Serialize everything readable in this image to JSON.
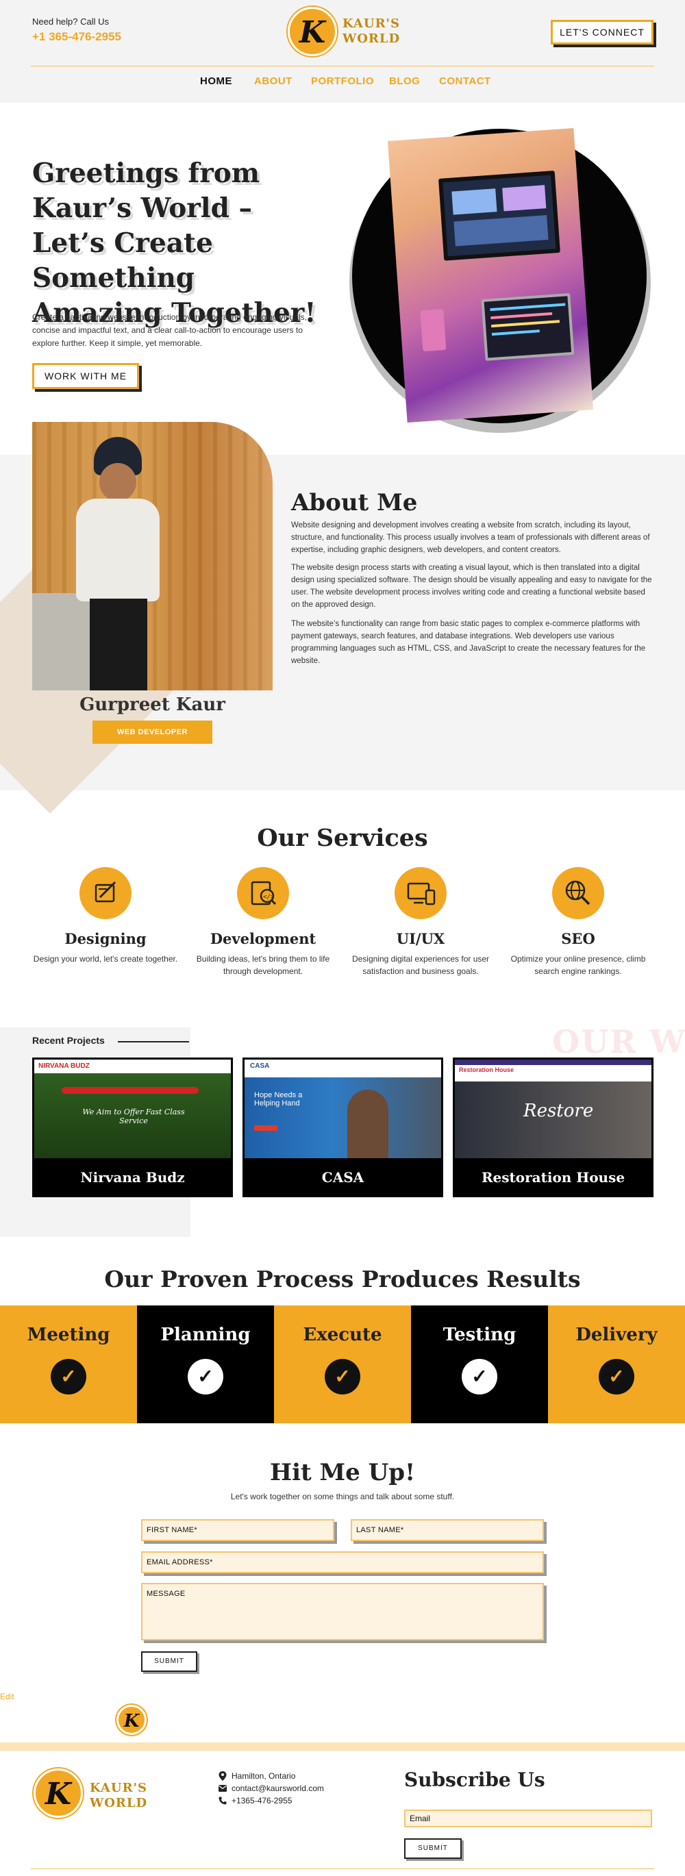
{
  "header": {
    "help_text": "Need help? Call Us",
    "phone": "+1 365-476-2955",
    "logo_line1": "KAUR'S",
    "logo_line2": "WORLD",
    "connect_label": "LET'S CONNECT",
    "nav": [
      {
        "label": "HOME",
        "active": true
      },
      {
        "label": "ABOUT"
      },
      {
        "label": "PORTFOLIO"
      },
      {
        "label": "BLOG"
      },
      {
        "label": "CONTACT"
      }
    ]
  },
  "hero": {
    "title": "Greetings from Kaur’s World – Let’s Create Something Amazing Together!",
    "text": "Create a captivating website introduction by incorporating engaging visuals, concise and impactful text, and a clear call-to-action to encourage users to explore further. Keep it simple, yet memorable.",
    "button_label": "WORK WITH ME"
  },
  "about": {
    "title": "About Me",
    "paragraphs": [
      "Website designing and development involves creating a website from scratch, including its layout, structure, and functionality. This process usually involves a team of professionals with different areas of expertise, including graphic designers, web developers, and content creators.",
      "The website design process starts with creating a visual layout, which is then translated into a digital design using specialized software. The design should be visually appealing and easy to navigate for the user. The website development process involves writing code and creating a functional website based on the approved design.",
      "The website’s functionality can range from basic static pages to complex e-commerce platforms with payment gateways, search features, and database integrations. Web developers use various programming languages such as HTML, CSS, and JavaScript to create the necessary features for the website."
    ],
    "name": "Gurpreet Kaur",
    "role": "WEB DEVELOPER"
  },
  "services": {
    "title": "Our Services",
    "items": [
      {
        "name": "Designing",
        "desc": "Design your world, let's create together.",
        "icon": "design-tool-icon"
      },
      {
        "name": "Development",
        "desc": "Building ideas, let's bring them to life through development.",
        "icon": "code-search-icon"
      },
      {
        "name": "UI/UX",
        "desc": "Designing digital experiences for user satisfaction and business goals.",
        "icon": "devices-icon"
      },
      {
        "name": "SEO",
        "desc": "Optimize your online presence, climb search engine rankings.",
        "icon": "globe-search-icon"
      }
    ]
  },
  "projects": {
    "label": "Recent Projects",
    "watermark": "OUR WO",
    "items": [
      {
        "name": "Nirvana Budz",
        "shot_brand": "NIRVANA BUDZ",
        "shot_headline": "We Aim to Offer Fast Class Service"
      },
      {
        "name": "CASA",
        "shot_brand": "CASA",
        "shot_headline": "Hope Needs a Helping Hand"
      },
      {
        "name": "Restoration House",
        "shot_brand": "Restoration House",
        "shot_headline": "Restore"
      }
    ]
  },
  "process": {
    "title": "Our Proven Process Produces Results",
    "steps": [
      {
        "name": "Meeting",
        "theme": "gold"
      },
      {
        "name": "Planning",
        "theme": "black"
      },
      {
        "name": "Execute",
        "theme": "gold"
      },
      {
        "name": "Testing",
        "theme": "black"
      },
      {
        "name": "Delivery",
        "theme": "gold"
      }
    ]
  },
  "contact": {
    "title": "Hit Me Up!",
    "subtitle": "Let's work together on some things and talk about some stuff.",
    "first_name": "FIRST NAME*",
    "last_name": "LAST NAME*",
    "email": "EMAIL ADDRESS*",
    "message": "MESSAGE",
    "submit": "SUBMIT",
    "edit": "Edit"
  },
  "footer": {
    "location": "Hamilton, Ontario",
    "email": "contact@kaursworld.com",
    "phone": "+1365-476-2955",
    "subscribe_title": "Subscribe Us",
    "email_placeholder": "Email",
    "submit": "SUBMIT"
  },
  "colors": {
    "accent": "#f0a81e",
    "dark": "#000000",
    "light_bg": "#f4f4f4"
  }
}
